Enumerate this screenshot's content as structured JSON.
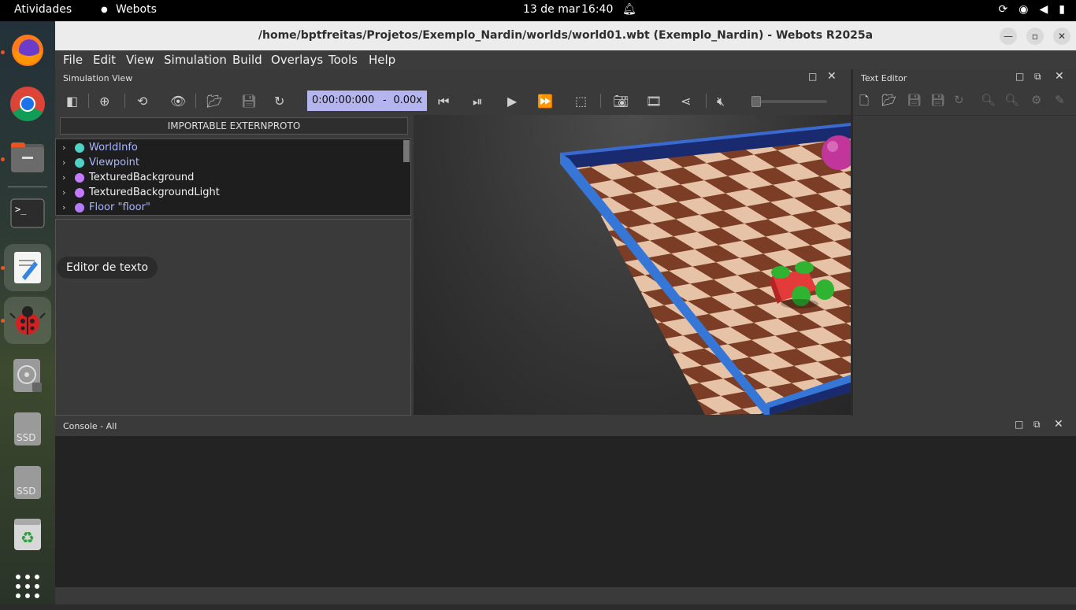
{
  "topbar": {
    "activities": "Atividades",
    "app_name": "Webots",
    "date": "13 de mar",
    "time": "16:40"
  },
  "dock": {
    "items": [
      {
        "name": "firefox-icon",
        "running": true
      },
      {
        "name": "chrome-icon",
        "running": false
      },
      {
        "name": "files-icon",
        "running": true
      },
      {
        "name": "terminal-icon",
        "running": false
      },
      {
        "name": "text-editor-icon",
        "running": true
      },
      {
        "name": "webots-icon",
        "running": true
      },
      {
        "name": "disk-icon",
        "running": false
      },
      {
        "name": "ssd-icon",
        "label": "SSD"
      },
      {
        "name": "ssd-icon",
        "label": "SSD"
      },
      {
        "name": "recycle-icon",
        "running": false
      },
      {
        "name": "app-grid-icon",
        "running": false
      }
    ],
    "tooltip": "Editor de texto"
  },
  "window": {
    "title": "/home/bptfreitas/Projetos/Exemplo_Nardin/worlds/world01.wbt (Exemplo_Nardin) - Webots R2025a"
  },
  "menu": [
    "File",
    "Edit",
    "View",
    "Simulation",
    "Build",
    "Overlays",
    "Tools",
    "Help"
  ],
  "simulation_view": {
    "title": "Simulation View",
    "time": "0:00:00:000",
    "separator": "-",
    "speed": "0.00x",
    "import_button": "IMPORTABLE EXTERNPROTO",
    "tree": [
      {
        "label": "WorldInfo",
        "color": "#4fd1c5",
        "text_color": "#a9b8ff"
      },
      {
        "label": "Viewpoint",
        "color": "#4fd1c5",
        "text_color": "#a9b8ff"
      },
      {
        "label": "TexturedBackground",
        "color": "#c57bff",
        "text_color": "#f0f0f0"
      },
      {
        "label": "TexturedBackgroundLight",
        "color": "#c57bff",
        "text_color": "#f0f0f0"
      },
      {
        "label": "Floor \"floor\"",
        "color": "#b57bff",
        "text_color": "#a9b8ff"
      }
    ]
  },
  "text_editor": {
    "title": "Text Editor"
  },
  "console": {
    "title": "Console - All"
  }
}
